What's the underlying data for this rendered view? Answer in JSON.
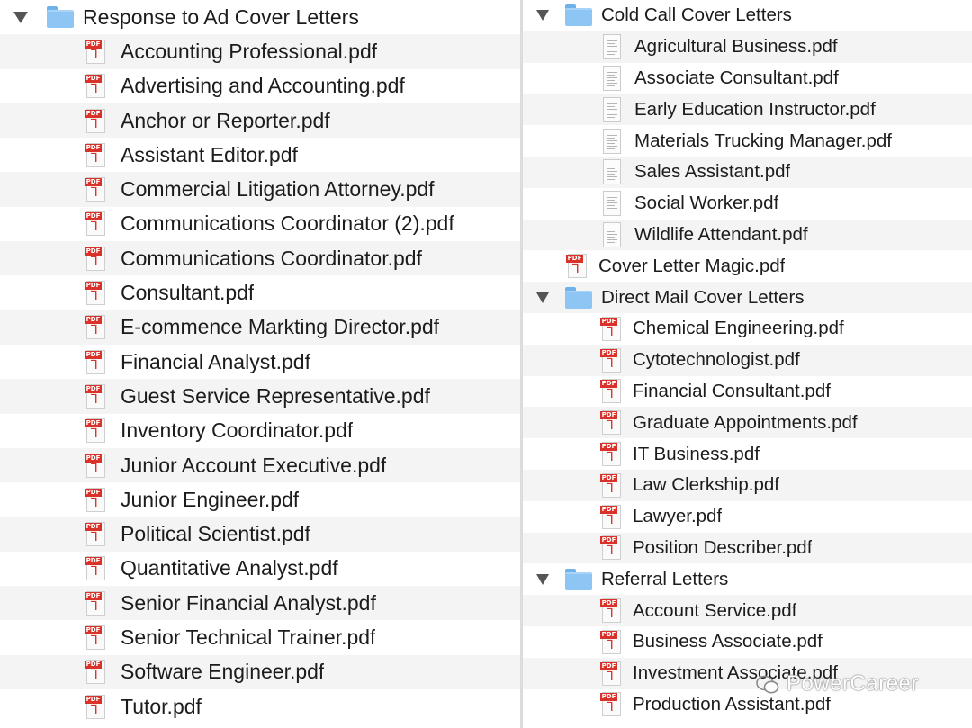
{
  "left": {
    "folder": "Response to Ad Cover Letters",
    "files": [
      "Accounting Professional.pdf",
      "Advertising and Accounting.pdf",
      "Anchor or Reporter.pdf",
      "Assistant Editor.pdf",
      "Commercial Litigation Attorney.pdf",
      "Communications Coordinator (2).pdf",
      "Communications Coordinator.pdf",
      "Consultant.pdf",
      "E-commence Markting Director.pdf",
      "Financial Analyst.pdf",
      "Guest Service Representative.pdf",
      "Inventory Coordinator.pdf",
      "Junior Account Executive.pdf",
      "Junior Engineer.pdf",
      "Political Scientist.pdf",
      "Quantitative Analyst.pdf",
      "Senior Financial Analyst.pdf",
      "Senior Technical Trainer.pdf",
      "Software Engineer.pdf",
      "Tutor.pdf"
    ]
  },
  "right": {
    "rows": [
      {
        "kind": "folder",
        "label": "Cold Call Cover Letters"
      },
      {
        "kind": "doc",
        "label": "Agricultural Business.pdf"
      },
      {
        "kind": "doc",
        "label": "Associate Consultant.pdf"
      },
      {
        "kind": "doc",
        "label": "Early Education Instructor.pdf"
      },
      {
        "kind": "doc",
        "label": "Materials Trucking Manager.pdf"
      },
      {
        "kind": "doc",
        "label": "Sales Assistant.pdf"
      },
      {
        "kind": "doc",
        "label": "Social Worker.pdf"
      },
      {
        "kind": "doc",
        "label": "Wildlife Attendant.pdf"
      },
      {
        "kind": "pdf-top",
        "label": "Cover Letter Magic.pdf"
      },
      {
        "kind": "folder",
        "label": "Direct Mail Cover Letters"
      },
      {
        "kind": "pdf",
        "label": "Chemical Engineering.pdf"
      },
      {
        "kind": "pdf",
        "label": "Cytotechnologist.pdf"
      },
      {
        "kind": "pdf",
        "label": "Financial Consultant.pdf"
      },
      {
        "kind": "pdf",
        "label": "Graduate Appointments.pdf"
      },
      {
        "kind": "pdf",
        "label": "IT Business.pdf"
      },
      {
        "kind": "pdf",
        "label": "Law Clerkship.pdf"
      },
      {
        "kind": "pdf",
        "label": "Lawyer.pdf"
      },
      {
        "kind": "pdf",
        "label": "Position Describer.pdf"
      },
      {
        "kind": "folder",
        "label": "Referral Letters"
      },
      {
        "kind": "pdf",
        "label": "Account Service.pdf"
      },
      {
        "kind": "pdf",
        "label": "Business Associate.pdf"
      },
      {
        "kind": "pdf",
        "label": "Investment Associate.pdf"
      },
      {
        "kind": "pdf",
        "label": "Production Assistant.pdf"
      }
    ]
  },
  "icons": {
    "disclosure": "disclosure-triangle-icon",
    "folder": "folder-icon",
    "pdf": "pdf-file-icon",
    "doc": "document-file-icon"
  },
  "colors": {
    "alt_row": "#f4f4f5",
    "folder": "#8dc6f4",
    "pdf_red": "#d9322a"
  },
  "pdf_badge": "PDF",
  "watermark": "PowerCareer"
}
